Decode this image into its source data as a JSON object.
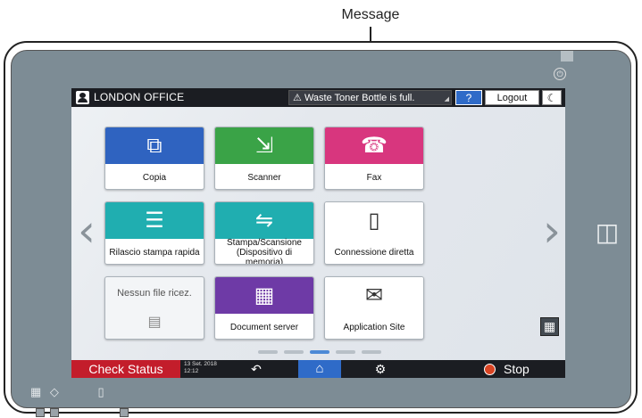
{
  "callout": {
    "label": "Message"
  },
  "status_bar": {
    "user_label": "LONDON OFFICE",
    "message": "Waste Toner Bottle is full.",
    "message_icon": "alert-icon",
    "help_label": "?",
    "logout_label": "Logout",
    "sleep_icon": "moon-icon"
  },
  "tiles": [
    {
      "label": "Copia",
      "color": "#2f63c0",
      "icon": "copy-icon",
      "glyph": "⧉"
    },
    {
      "label": "Scanner",
      "color": "#3aa347",
      "icon": "scanner-icon",
      "glyph": "⇲"
    },
    {
      "label": "Fax",
      "color": "#d8367e",
      "icon": "fax-icon",
      "glyph": "☎"
    },
    {
      "label": "Rilascio stampa rapida",
      "color": "#20aeb0",
      "icon": "quick-print-icon",
      "glyph": "☰"
    },
    {
      "label": "Stampa/Scansione (Dispositivo di memoria)",
      "color": "#20aeb0",
      "icon": "usb-sd-icon",
      "glyph": "⇋"
    },
    {
      "label": "Connessione diretta",
      "color": "#ffffff",
      "icon": "phone-connect-icon",
      "glyph": "▯"
    },
    {
      "label": "Nessun file ricez.",
      "icon": "fax-received-icon",
      "glyph": "▤"
    },
    {
      "label": "Document server",
      "color": "#6e3aa6",
      "icon": "document-server-icon",
      "glyph": "▦"
    },
    {
      "label": "Application Site",
      "color": "#ffffff",
      "icon": "shopping-bag-icon",
      "glyph": "✉"
    }
  ],
  "page_indicator": {
    "count": 5,
    "active_index": 2
  },
  "bottom_bar": {
    "check_status_label": "Check Status",
    "date": "13 Set. 2018",
    "time": "12:12",
    "back_icon": "back-icon",
    "home_icon": "home-icon",
    "settings_icon": "gear-icon",
    "stop_label": "Stop"
  }
}
